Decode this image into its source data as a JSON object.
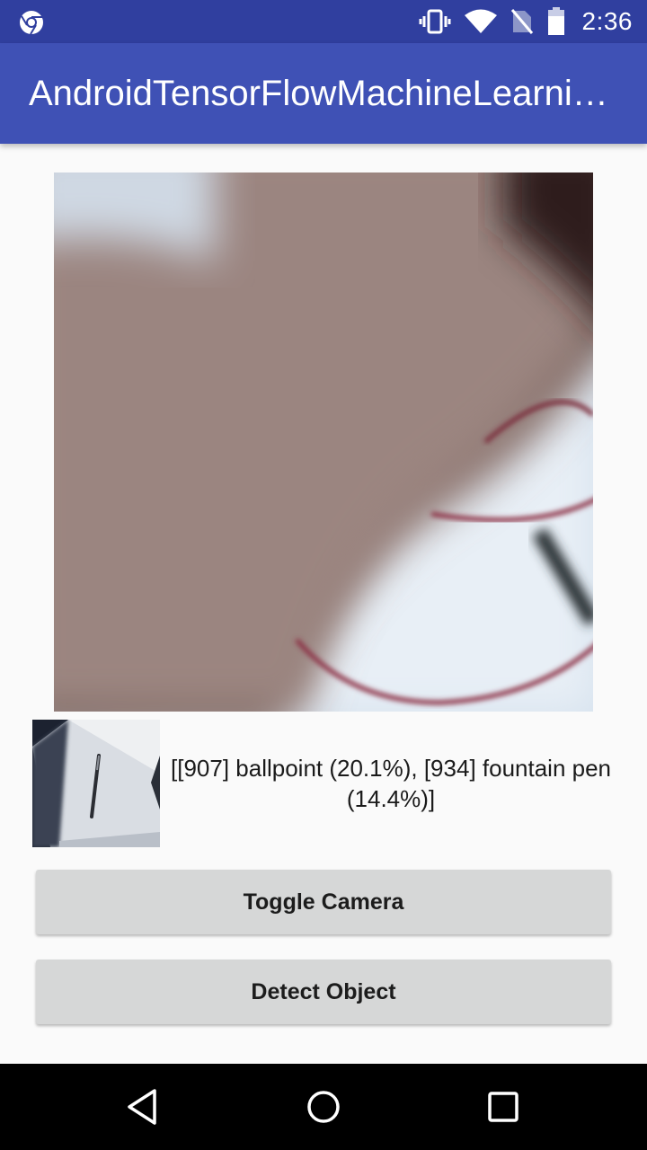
{
  "status_bar": {
    "time": "2:36",
    "icons": [
      "chrome-icon",
      "vibrate-icon",
      "wifi-icon",
      "no-sim-icon",
      "battery-icon"
    ]
  },
  "app_bar": {
    "title": "AndroidTensorFlowMachineLearni…"
  },
  "preview": {
    "icon": "camera-preview-image"
  },
  "result": {
    "text": "[[907] ballpoint (20.1%), [934] fountain pen (14.4%)]"
  },
  "buttons": {
    "toggle_camera": "Toggle Camera",
    "detect_object": "Detect Object"
  },
  "nav": {
    "icons": [
      "back-icon",
      "home-icon",
      "recents-icon"
    ]
  },
  "colors": {
    "status_bar": "#303f9f",
    "app_bar": "#3f51b5",
    "background": "#fafafa",
    "button": "#d6d7d7"
  }
}
